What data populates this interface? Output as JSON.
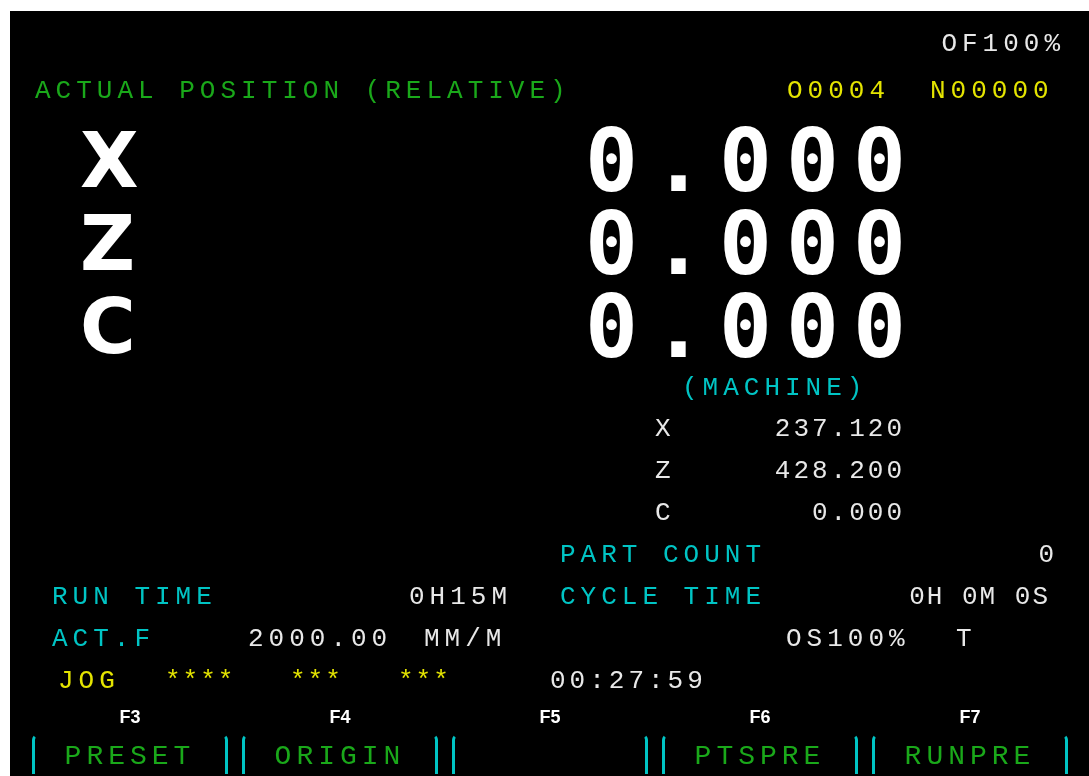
{
  "override": "OF100%",
  "header": {
    "title": "ACTUAL POSITION (RELATIVE)",
    "program": "O0004",
    "sequence": "N00000"
  },
  "relative": [
    {
      "axis": "X",
      "value": "0.000"
    },
    {
      "axis": "Z",
      "value": "0.000"
    },
    {
      "axis": "C",
      "value": "0.000"
    }
  ],
  "machine": {
    "title": "(MACHINE)",
    "axes": [
      {
        "axis": "X",
        "value": "237.120"
      },
      {
        "axis": "Z",
        "value": "428.200"
      },
      {
        "axis": "C",
        "value": "0.000"
      }
    ]
  },
  "part_count": {
    "label": "PART COUNT",
    "value": "0"
  },
  "run_time": {
    "label": "RUN TIME",
    "value": "0H15M"
  },
  "cycle_time": {
    "label": "CYCLE TIME",
    "value": "0H 0M 0S"
  },
  "feed": {
    "label": "ACT.F",
    "value": "2000.00",
    "unit": "MM/M"
  },
  "spindle_override": "OS100%",
  "tool": "T",
  "status": {
    "mode": "JOG",
    "fields": [
      "****",
      "***",
      "***"
    ],
    "clock": "00:27:59"
  },
  "softkeys": [
    {
      "key": "F3",
      "label": "PRESET"
    },
    {
      "key": "F4",
      "label": "ORIGIN"
    },
    {
      "key": "F5"
    },
    {
      "key": "F6",
      "label": "PTSPRE"
    },
    {
      "key": "F7",
      "label": "RUNPRE"
    }
  ]
}
